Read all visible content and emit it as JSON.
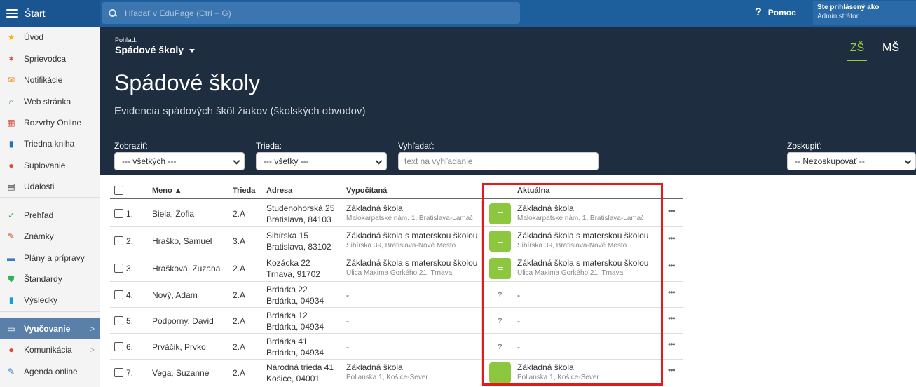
{
  "topbar": {
    "start_label": "Štart",
    "search_placeholder": "Hľadať v EduPage (Ctrl + G)",
    "help_icon": "?",
    "help_label": "Pomoc",
    "user_line1": "Ste prihlásený ako",
    "user_line2": "Administrátor"
  },
  "sidebar": {
    "items": [
      {
        "label": "Úvod",
        "icon": "star-icon",
        "glyph": "★",
        "color": "#f5b800"
      },
      {
        "label": "Sprievodca",
        "icon": "magic-wand-icon",
        "glyph": "✶",
        "color": "#d9453c"
      },
      {
        "label": "Notifikácie",
        "icon": "envelope-icon",
        "glyph": "✉",
        "color": "#f08c1a"
      },
      {
        "label": "Web stránka",
        "icon": "house-icon",
        "glyph": "⌂",
        "color": "#2e8b57"
      },
      {
        "label": "Rozvrhy Online",
        "icon": "timetable-grid-icon",
        "glyph": "▦",
        "color": "#d9453c"
      },
      {
        "label": "Triedna kniha",
        "icon": "book-icon",
        "glyph": "▮",
        "color": "#1e73be"
      },
      {
        "label": "Suplovanie",
        "icon": "person-icon",
        "glyph": "●",
        "color": "#e0452f"
      },
      {
        "label": "Udalosti",
        "icon": "calendar-icon",
        "glyph": "▤",
        "color": "#333333"
      },
      {
        "label": "Prehľad",
        "icon": "check-circle-icon",
        "glyph": "✓",
        "color": "#2eb35a"
      },
      {
        "label": "Známky",
        "icon": "grades-icon",
        "glyph": "✎",
        "color": "#e0452f"
      },
      {
        "label": "Plány a prípravy",
        "icon": "briefcase-icon",
        "glyph": "▬",
        "color": "#3a7cc2"
      },
      {
        "label": "Štandardy",
        "icon": "shield-icon",
        "glyph": "⛊",
        "color": "#2eb35a"
      },
      {
        "label": "Výsledky",
        "icon": "bar-chart-icon",
        "glyph": "▮",
        "color": "#1e9ad6"
      },
      {
        "label": "Vyučovanie",
        "icon": "open-book-icon",
        "glyph": "▭",
        "color": "#ffffff"
      },
      {
        "label": "Komunikácia",
        "icon": "chat-bubbles-icon",
        "glyph": "●",
        "color": "#e0452f"
      },
      {
        "label": "Agenda online",
        "icon": "pencil-icon",
        "glyph": "✎",
        "color": "#3a7cc2"
      }
    ],
    "arrow": ">"
  },
  "header": {
    "view_small": "Pohľad:",
    "view_big": "Spádové školy",
    "tab_zs": "ZŠ",
    "tab_ms": "MŠ",
    "title": "Spádové školy",
    "subtitle": "Evidencia spádových škôl žiakov (školských obvodov)"
  },
  "filters": {
    "show_label": "Zobraziť:",
    "show_value": "--- všetkých ---",
    "class_label": "Trieda:",
    "class_value": "--- všetky ---",
    "search_label": "Vyhľadať:",
    "search_placeholder": "text na vyhľadanie",
    "group_label": "Zoskupiť:",
    "group_value": "-- Nezoskupovať --"
  },
  "table": {
    "headers": {
      "name": "Meno ▲",
      "class": "Trieda",
      "address": "Adresa",
      "computed": "Vypočítaná",
      "current": "Aktuálna"
    },
    "rows": [
      {
        "num": "1.",
        "name": "Biela, Žofia",
        "class": "2.A",
        "addr1": "Studenohorská 25",
        "addr2": "Bratislava, 84103",
        "comp1": "Základná škola",
        "comp2": "Malokarpatské nám. 1, Bratislava-Lamač",
        "status": "=",
        "cur1": "Základná škola",
        "cur2": "Malokarpatské nám. 1, Bratislava-Lamač"
      },
      {
        "num": "2.",
        "name": "Hraško, Samuel",
        "class": "3.A",
        "addr1": "Sibírska 15",
        "addr2": "Bratislava, 83102",
        "comp1": "Základná škola s materskou školou",
        "comp2": "Sibírska 39, Bratislava-Nové Mesto",
        "status": "=",
        "cur1": "Základná škola s materskou školou",
        "cur2": "Sibírska 39, Bratislava-Nové Mesto"
      },
      {
        "num": "3.",
        "name": "Hrašková, Zuzana",
        "class": "2.A",
        "addr1": "Kozácka 22",
        "addr2": "Trnava, 91702",
        "comp1": "Základná škola s materskou školou",
        "comp2": "Ulica Maxima Gorkého 21, Trnava",
        "status": "=",
        "cur1": "Základná škola s materskou školou",
        "cur2": "Ulica Maxima Gorkého 21, Trnava"
      },
      {
        "num": "4.",
        "name": "Nový, Adam",
        "class": "2.A",
        "addr1": "Brdárka 22",
        "addr2": "Brdárka, 04934",
        "comp1": "-",
        "comp2": "",
        "status": "?",
        "cur1": "-",
        "cur2": ""
      },
      {
        "num": "5.",
        "name": "Podporny, David",
        "class": "2.A",
        "addr1": "Brdárka 12",
        "addr2": "Brdárka, 04934",
        "comp1": "-",
        "comp2": "",
        "status": "?",
        "cur1": "-",
        "cur2": ""
      },
      {
        "num": "6.",
        "name": "Prváčik, Prvko",
        "class": "2.A",
        "addr1": "Brdárka 41",
        "addr2": "Brdárka, 04934",
        "comp1": "-",
        "comp2": "",
        "status": "?",
        "cur1": "-",
        "cur2": ""
      },
      {
        "num": "7.",
        "name": "Vega, Suzanne",
        "class": "2.A",
        "addr1": "Národná trieda 41",
        "addr2": "Košice, 04001",
        "comp1": "Základná škola",
        "comp2": "Polianska 1, Košice-Sever",
        "status": "=",
        "cur1": "Základná škola",
        "cur2": "Polianska 1, Košice-Sever"
      }
    ],
    "more_glyph": "•••"
  },
  "colors": {
    "topbar": "#1d5e9c",
    "panel": "#1e2d40",
    "accent_green": "#8dc63f",
    "highlight_red": "#e8161d"
  }
}
